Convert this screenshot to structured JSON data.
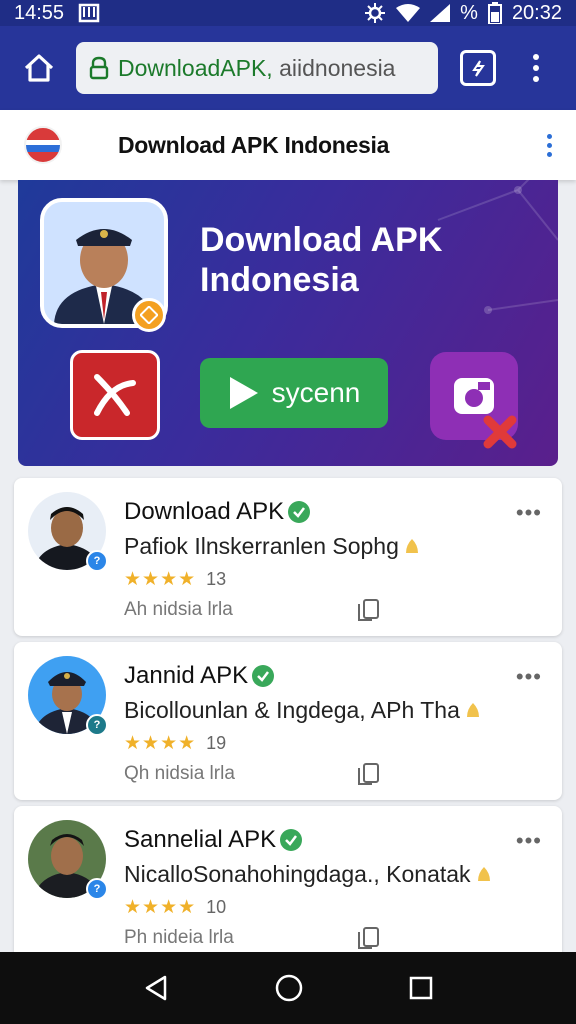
{
  "status": {
    "time_left": "14:55",
    "time_right": "20:32",
    "battery_label": "%"
  },
  "browser": {
    "url_primary": "DownloadAPK, ",
    "url_secondary": "aiidnonesia"
  },
  "site": {
    "title": "Download APK Indonesia"
  },
  "banner": {
    "title": "Download APK Indonesia",
    "play_label": "sycenn"
  },
  "cards": [
    {
      "name": "Download APK",
      "desc": "Pafiok Ilnskerranlen Sophg",
      "rating": "13",
      "sub": "Ah nidsia lrla",
      "stars": "★★★★"
    },
    {
      "name": "Jannid APK",
      "desc": "Bicollounlan & Ingdega, APh Tha",
      "rating": "19",
      "sub": "Qh nidsia lrla",
      "stars": "★★★★"
    },
    {
      "name": "Sannelial APK",
      "desc": "NicalloSonahohingdaga., Konatak",
      "rating": "10",
      "sub": "Ph nideia lrla",
      "stars": "★★★★"
    }
  ],
  "icons": {
    "home": "home-icon",
    "lock": "lock-icon",
    "tabs": "tab-switcher-icon",
    "menu": "more-vert-icon",
    "back": "back-icon",
    "home_nav": "home-circle-icon",
    "recents": "recents-icon"
  },
  "colors": {
    "status_bar": "#1f2d86",
    "toolbar": "#27359a",
    "url_green": "#1c7a2b",
    "star": "#f0b12a",
    "verified": "#39a85a"
  }
}
